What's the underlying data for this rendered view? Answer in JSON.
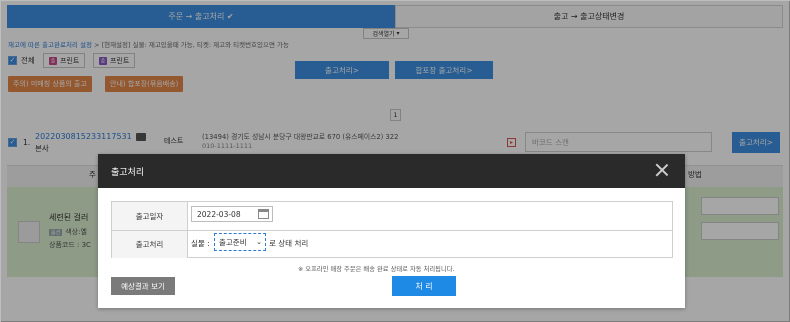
{
  "tabs": {
    "active": "주문 → 출고처리 ✔",
    "inactive": "출고 → 출고상태변경"
  },
  "search_toggle": {
    "label": "검색열기",
    "arrow": "▾"
  },
  "settings": {
    "link": "재고에 따른 출고완료처리 설정",
    "separator": ">",
    "text": "[현재설정] 실물: 재고있을때 가능,  티켓: 재고와 티켓번호있으면 가능"
  },
  "toolbar": {
    "select_all_label": "전체",
    "print1_label": "프린트",
    "print2_label": "프린트",
    "process_label": "출고처리>",
    "combined_label": "합포장 출고처리>",
    "warn_unsold_label": "주의) 미매칭 상품의 출고",
    "guide_combined_label": "안내) 합포장(묶음배송)"
  },
  "pagination": {
    "page": "1"
  },
  "order": {
    "index": "1.",
    "order_no": "2022030815233117531",
    "branch": "본사",
    "customer": "테스트",
    "address": "(13494) 경기도 성남시 분당구 대왕판교로 670 (유스페이스2) 322",
    "phone": "010-1111-1111",
    "barcode_placeholder": "바코드 스캔",
    "process_button": "출고처리>"
  },
  "table_header": {
    "col_partial": "주",
    "method_partial": "방법"
  },
  "product": {
    "name_partial": "세련된 걸러",
    "option_partial": "색상:옐",
    "code_partial": "상품코드 : 3C",
    "tag": "옵션"
  },
  "modal": {
    "title": "출고처리",
    "ship_date_label": "출고일자",
    "ship_date_value": "2022-03-08",
    "process_label": "출고처리",
    "physical_prefix": "실물 :",
    "status_value": "출고준비",
    "status_suffix": "로 상태 처리",
    "notice": "※ 오프라인 매장 주문은 배송 완료 상태로 자동 처리됩니다.",
    "preview_button": "예상결과 보기",
    "process_button": "처 리"
  }
}
